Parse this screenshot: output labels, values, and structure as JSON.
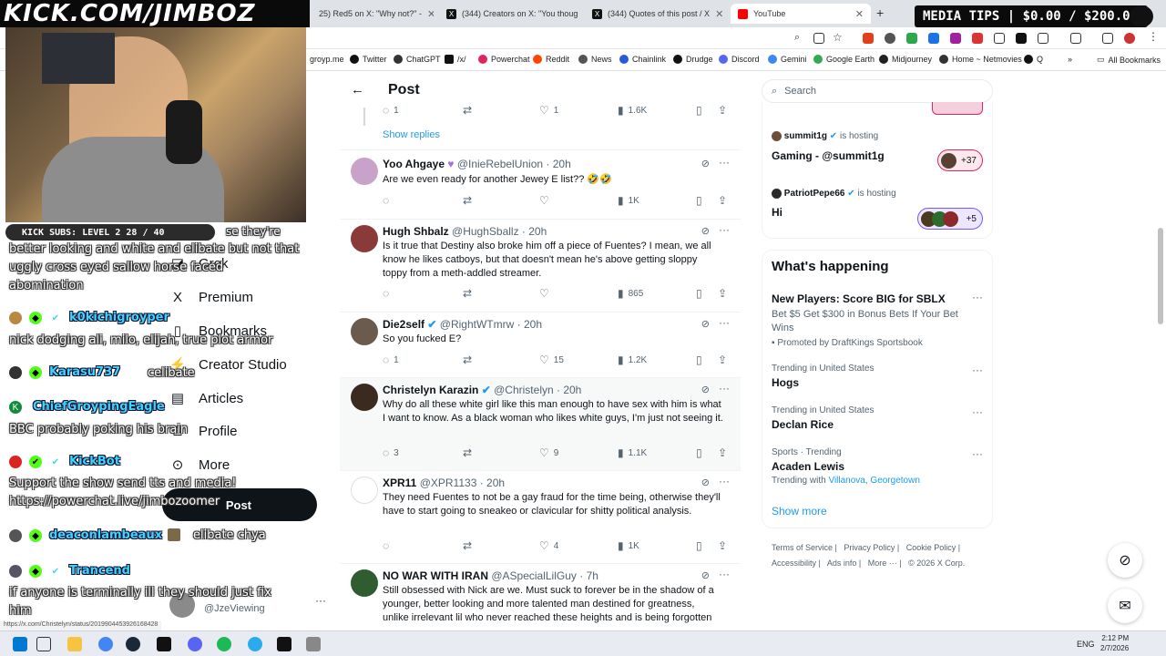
{
  "overlay": {
    "brand": "KICK.COM/JIMBOZ",
    "media_tips": "MEDIA TIPS | $0.00 / $200.00",
    "kick_subs": "KICK SUBS: LEVEL 2 28 / 40"
  },
  "browser": {
    "tabs": [
      {
        "label": "25) Red5 on X: \"Why not?\" -",
        "color": "#111"
      },
      {
        "label": "(344) Creators on X: \"You thoug",
        "color": "#111"
      },
      {
        "label": "(344) Quotes of this post / X",
        "color": "#111"
      },
      {
        "label": "YouTube",
        "color": "#ff0000"
      }
    ],
    "bookmarks": [
      {
        "label": "groyp.me",
        "color": "#444"
      },
      {
        "label": "Twitter",
        "color": "#111"
      },
      {
        "label": "ChatGPT",
        "color": "#333"
      },
      {
        "label": "/x/",
        "color": "#111"
      },
      {
        "label": "Powerchat",
        "color": "#e0245e"
      },
      {
        "label": "Reddit",
        "color": "#ff4500"
      },
      {
        "label": "News",
        "color": "#555"
      },
      {
        "label": "Chainlink",
        "color": "#2a5ada"
      },
      {
        "label": "Drudge",
        "color": "#111"
      },
      {
        "label": "Discord",
        "color": "#5865f2"
      },
      {
        "label": "Gemini",
        "color": "#4285f4"
      },
      {
        "label": "Google Earth",
        "color": "#34a853"
      },
      {
        "label": "Midjourney",
        "color": "#222"
      },
      {
        "label": "Home ~ Netmovies",
        "color": "#333"
      },
      {
        "label": "Q",
        "color": "#111"
      }
    ],
    "all_bookmarks": "All Bookmarks",
    "status_url": "https://x.com/Christelyn/status/2019904453926168428"
  },
  "nav": {
    "items": [
      "Grok",
      "Premium",
      "Bookmarks",
      "Creator Studio",
      "Articles",
      "Profile",
      "More"
    ],
    "post_button": "Post",
    "account_handle": "@JzeViewing"
  },
  "chat": [
    {
      "user": "",
      "text": "better looking and white and elibate but not that uggly cross eyed sallow horse faced abomination"
    },
    {
      "user": "k0kichigroyper",
      "text": "nick dodging ali, milo, elijah, true plot armor"
    },
    {
      "user": "Karasu737",
      "text": "celibate"
    },
    {
      "user": "ChiefGroypingEagle",
      "text": "BBC probably poking his brain"
    },
    {
      "user": "KickBot",
      "text": "Support the show send tts and media! https://powerchat.live/jimbozoomer"
    },
    {
      "user": "deaconlambeaux",
      "text": "elibate chya"
    },
    {
      "user": "Trancend",
      "text": "if anyone is terminally ill they should just fix him"
    },
    {
      "partial": "se they're"
    }
  ],
  "post_page": {
    "title": "Post",
    "show_replies": "Show replies",
    "top_stats": {
      "replies": "1",
      "likes": "1",
      "views": "1.6K"
    },
    "tweets": [
      {
        "name": "Yoo Ahgaye",
        "handle": "@InieRebelUnion",
        "time": "20h",
        "text": "Are we even ready for another Jewey E list?? 🤣🤣",
        "replies": "",
        "likes": "",
        "views": "1K",
        "avatar": "#c8a2c8"
      },
      {
        "name": "Hugh Shbalz",
        "handle": "@HughSballz",
        "time": "20h",
        "text": "Is it true that Destiny also broke him off a piece of Fuentes? I mean, we all know he likes catboys, but that doesn't mean he's above getting sloppy toppy from a meth-addled streamer.",
        "replies": "",
        "likes": "",
        "views": "865",
        "avatar": "#8b3a3a"
      },
      {
        "name": "Die2self",
        "handle": "@RightWTmrw",
        "time": "20h",
        "text": "So you fucked E?",
        "replies": "1",
        "likes": "15",
        "views": "1.2K",
        "avatar": "#6b5a4e"
      },
      {
        "name": "Christelyn Karazin",
        "handle": "@Christelyn",
        "time": "20h",
        "text": "Why do all these white girl like this man enough to have sex with him is what I want to know. As a black woman who likes white guys, I'm just not seeing it.",
        "replies": "3",
        "likes": "9",
        "views": "1.1K",
        "avatar": "#3b2a20"
      },
      {
        "name": "XPR11",
        "handle": "@XPR1133",
        "time": "20h",
        "text": "They need Fuentes to not be a gay fraud for the time being, otherwise they'll have to start going to sneakeo or clavicular for shitty political analysis.",
        "replies": "",
        "likes": "4",
        "views": "1K",
        "avatar": "#ffffff"
      },
      {
        "name": "NO WAR WITH IRAN",
        "handle": "@ASpecialLilGuy",
        "time": "7h",
        "text": "Still obsessed with Nick are we. Must suck to forever be in the shadow of a younger, better looking and more talented man destined for greatness, unlike irrelevant lil who never reached these heights and is being forgotten",
        "replies": "",
        "likes": "",
        "views": "",
        "avatar": "#2f5d2f"
      }
    ]
  },
  "sidebar": {
    "search_placeholder": "Search",
    "spaces": [
      {
        "host": "summit1g",
        "hosting": "is hosting",
        "title": "Gaming - @summit1g",
        "count": "+37"
      },
      {
        "host": "PatriotPepe66",
        "hosting": "is hosting",
        "title": "Hi",
        "count": "+5"
      }
    ],
    "whats_happening": "What's happening",
    "trends": [
      {
        "meta": "",
        "title": "New Players: Score BIG for SBLX",
        "desc": "Bet $5 Get $300 in Bonus Bets If Your Bet Wins",
        "promo": "Promoted by DraftKings Sportsbook"
      },
      {
        "meta": "Trending in United States",
        "title": "Hogs"
      },
      {
        "meta": "Trending in United States",
        "title": "Declan Rice"
      },
      {
        "meta": "Sports · Trending",
        "title": "Acaden Lewis",
        "desc_prefix": "Trending with",
        "links": "Villanova, Georgetown"
      }
    ],
    "show_more": "Show more",
    "footer": [
      "Terms of Service",
      "Privacy Policy",
      "Cookie Policy",
      "Accessibility",
      "Ads info",
      "More ···",
      "© 2026 X Corp."
    ]
  },
  "taskbar": {
    "lang": "ENG",
    "time": "2:12 PM",
    "date": "2/7/2026"
  }
}
